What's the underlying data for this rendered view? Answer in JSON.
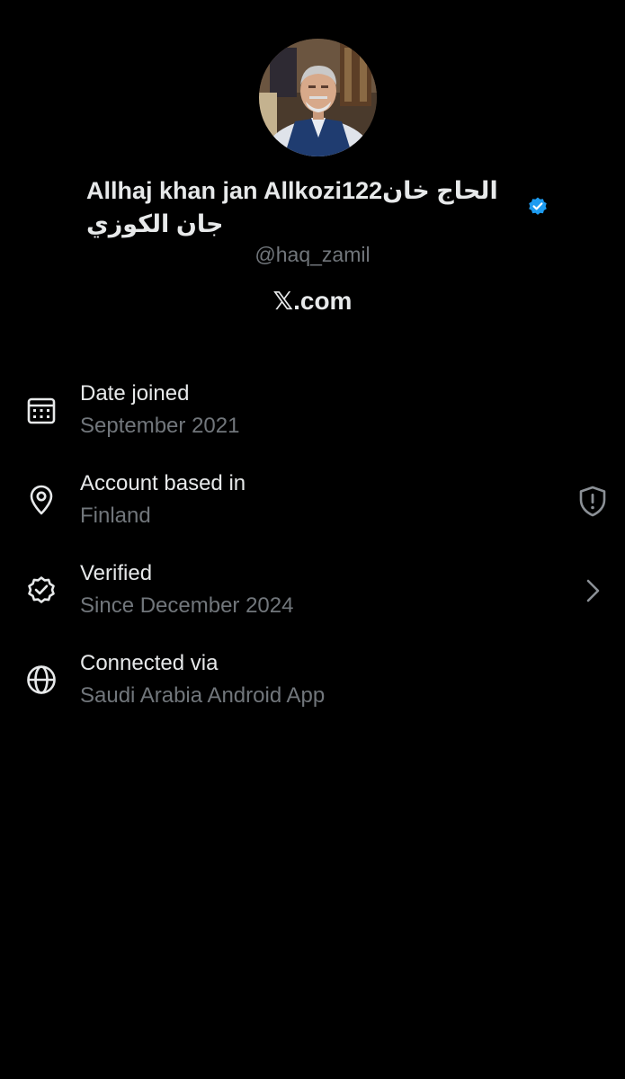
{
  "profile": {
    "display_name": "Allhaj khan jan Allkozi122الحاج خان جان الکوزي",
    "handle": "@haq_zamil",
    "site": "𝕏.com",
    "verified_badge_color": "#1d9bf0"
  },
  "about": {
    "items": [
      {
        "icon": "calendar-icon",
        "title": "Date joined",
        "value": "September 2021"
      },
      {
        "icon": "location-pin-icon",
        "title": "Account based in",
        "value": "Finland",
        "trailing_icon": "shield-alert-icon"
      },
      {
        "icon": "verified-check-icon",
        "title": "Verified",
        "value": "Since December 2024",
        "trailing_icon": "chevron-right-icon"
      },
      {
        "icon": "globe-icon",
        "title": "Connected via",
        "value": "Saudi Arabia Android App"
      }
    ]
  },
  "colors": {
    "background": "#000000",
    "primary_text": "#e7e9ea",
    "secondary_text": "#71767b",
    "accent": "#1d9bf0"
  }
}
